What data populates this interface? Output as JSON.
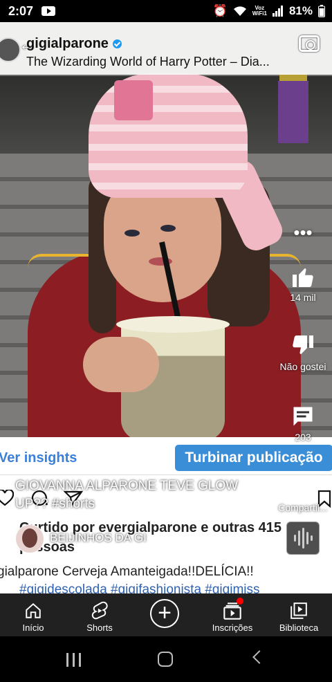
{
  "status_bar": {
    "time": "2:07",
    "net_line1": "Voz",
    "net_line2": "WiFi1",
    "battery": "81%"
  },
  "instagram": {
    "username": "gigialparone",
    "subtitle": "The Wizarding World of Harry Potter – Dia...",
    "insights": "Ver insights",
    "boost": "Turbinar publicação",
    "likes_line1": "Curtido por evergialparone e outras 415",
    "likes_line2": "pessoas",
    "caption": "gialparone Cerveja Amanteigada!!DELÍCIA!!",
    "hashtags": "#gigidescolada #gigifashionista #gigimiss"
  },
  "short": {
    "title": "GIOVANNA ALPARONE TEVE GLOW UP?? #shorts",
    "channel": "BEIJINHOS DA GI"
  },
  "actions": {
    "like_count": "14 mil",
    "dislike_label": "Não gostei",
    "comment_count": "203",
    "share_label": "Compartil..."
  },
  "nav": {
    "home": "Início",
    "shorts": "Shorts",
    "subscriptions": "Inscrições",
    "library": "Biblioteca"
  },
  "colors": {
    "accent_blue": "#3a8ed8",
    "nav_bg": "#212121",
    "notification": "#ff0000"
  },
  "icons": [
    "youtube-icon",
    "alarm-icon",
    "wifi-icon",
    "signal-icon",
    "battery-icon",
    "back-arrow-icon",
    "verified-icon",
    "camera-icon",
    "more-vert-icon",
    "like-icon",
    "dislike-icon",
    "comment-icon",
    "share-icon",
    "heart-icon",
    "ig-comment-icon",
    "ig-send-icon",
    "ig-save-icon",
    "sound-icon",
    "home-icon",
    "shorts-icon",
    "create-icon",
    "subscriptions-icon",
    "library-icon"
  ]
}
